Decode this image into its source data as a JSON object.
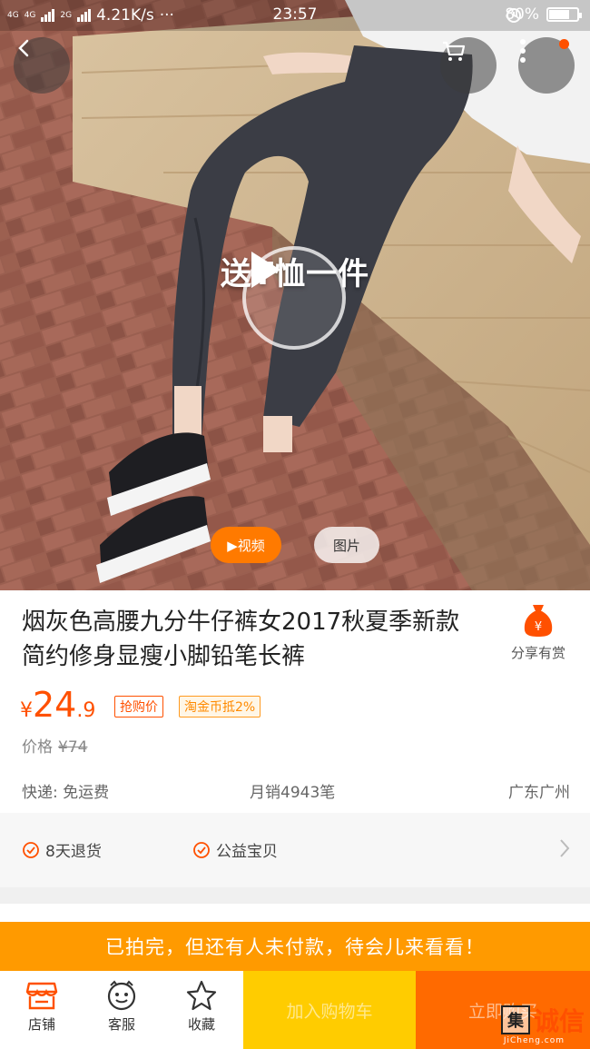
{
  "status_bar": {
    "network_left": "4G",
    "network_left2": "4G",
    "network_mid": "2G",
    "speed": "4.21K/s",
    "more": "···",
    "time": "23:57",
    "battery": "80%",
    "battery_level": 0.8
  },
  "hero": {
    "promo_text": "送T恤一件",
    "tabs": {
      "video": "▶视频",
      "pictures": "图片"
    },
    "icons": [
      "back-icon",
      "cart-icon",
      "more-icon",
      "play-icon"
    ]
  },
  "product": {
    "title": "烟灰色高腰九分牛仔裤女2017秋夏季新款简约修身显瘦小脚铅笔长裤",
    "share_label": "分享有赏",
    "price": {
      "currency": "¥",
      "integer": "24",
      "decimal": ".9"
    },
    "tags": {
      "grab": "抢购价",
      "coin": "淘金币抵2%"
    },
    "original_price": {
      "label": "价格",
      "value": "¥74"
    },
    "shipping": "快递: 免运费",
    "sales": "月销4943笔",
    "location": "广东广州"
  },
  "services": {
    "items": [
      "8天退货",
      "公益宝贝"
    ]
  },
  "notice": "已拍完，但还有人未付款，待会儿来看看！",
  "bottom_nav": {
    "store": "店铺",
    "service": "客服",
    "favorite": "收藏",
    "add_to_cart": "加入购物车",
    "buy_now": "立即购买"
  },
  "watermark": {
    "box": "集",
    "text": "诚信",
    "url": "JiCheng.com"
  },
  "colors": {
    "accent": "#ff5000",
    "orange": "#ff9a00",
    "cart_yellow": "#ffcc00",
    "buy_orange": "#ff6a00"
  }
}
